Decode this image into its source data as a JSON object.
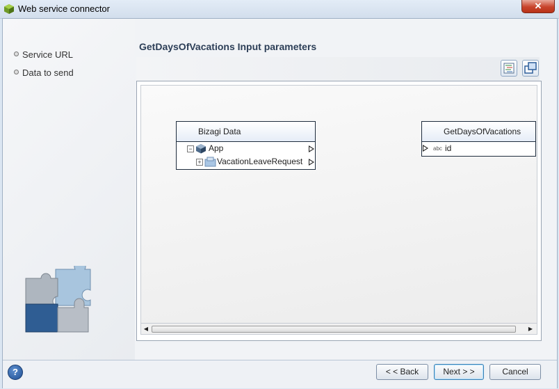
{
  "window": {
    "title": "Web service connector",
    "close_label": "✕"
  },
  "nav": {
    "items": [
      {
        "label": "Service URL"
      },
      {
        "label": "Data to send"
      }
    ]
  },
  "page": {
    "title": "GetDaysOfVacations Input parameters"
  },
  "toolbar": {
    "icons": [
      "auto-map-icon",
      "copy-window-icon"
    ]
  },
  "mapping": {
    "source": {
      "title": "Bizagi Data",
      "rows": [
        {
          "label": "App",
          "expander": "−"
        },
        {
          "label": "VacationLeaveRequest",
          "expander": "+"
        }
      ]
    },
    "target": {
      "title": "GetDaysOfVacations",
      "rows": [
        {
          "type_label": "abc",
          "label": "id"
        }
      ]
    }
  },
  "footer": {
    "help_label": "?",
    "back_label": "< < Back",
    "next_label": "Next > >",
    "cancel_label": "Cancel"
  },
  "colors": {
    "accent": "#2c3e57",
    "close": "#c8442c"
  }
}
